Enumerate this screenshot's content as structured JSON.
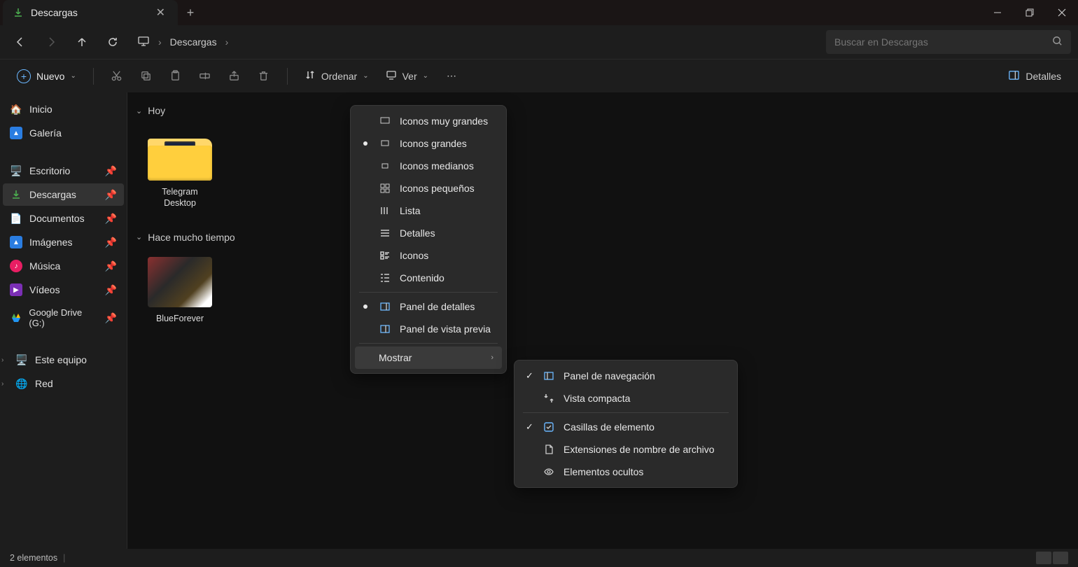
{
  "tab": {
    "title": "Descargas"
  },
  "breadcrumb": {
    "location": "Descargas"
  },
  "search": {
    "placeholder": "Buscar en Descargas"
  },
  "toolbar": {
    "new_label": "Nuevo",
    "sort_label": "Ordenar",
    "view_label": "Ver",
    "details_label": "Detalles"
  },
  "sidebar": {
    "home": "Inicio",
    "gallery": "Galería",
    "pinned": [
      {
        "label": "Escritorio",
        "icon": "desktop"
      },
      {
        "label": "Descargas",
        "icon": "download",
        "active": true
      },
      {
        "label": "Documentos",
        "icon": "documents"
      },
      {
        "label": "Imágenes",
        "icon": "images"
      },
      {
        "label": "Música",
        "icon": "music"
      },
      {
        "label": "Vídeos",
        "icon": "videos"
      },
      {
        "label": "Google Drive (G:)",
        "icon": "gdrive"
      }
    ],
    "this_pc": "Este equipo",
    "network": "Red"
  },
  "groups": [
    {
      "title": "Hoy",
      "items": [
        {
          "name": "Telegram Desktop",
          "type": "folder"
        }
      ]
    },
    {
      "title": "Hace mucho tiempo",
      "items": [
        {
          "name": "BlueForever",
          "type": "image"
        }
      ]
    }
  ],
  "view_menu": {
    "xl_icons": "Iconos muy grandes",
    "l_icons": "Iconos grandes",
    "m_icons": "Iconos medianos",
    "s_icons": "Iconos pequeños",
    "list": "Lista",
    "details": "Detalles",
    "tiles": "Iconos",
    "content": "Contenido",
    "details_pane": "Panel de detalles",
    "preview_pane": "Panel de vista previa",
    "show": "Mostrar"
  },
  "show_menu": {
    "nav_pane": "Panel de navegación",
    "compact": "Vista compacta",
    "checkboxes": "Casillas de elemento",
    "extensions": "Extensiones de nombre de archivo",
    "hidden": "Elementos ocultos"
  },
  "status": {
    "count": "2 elementos"
  }
}
